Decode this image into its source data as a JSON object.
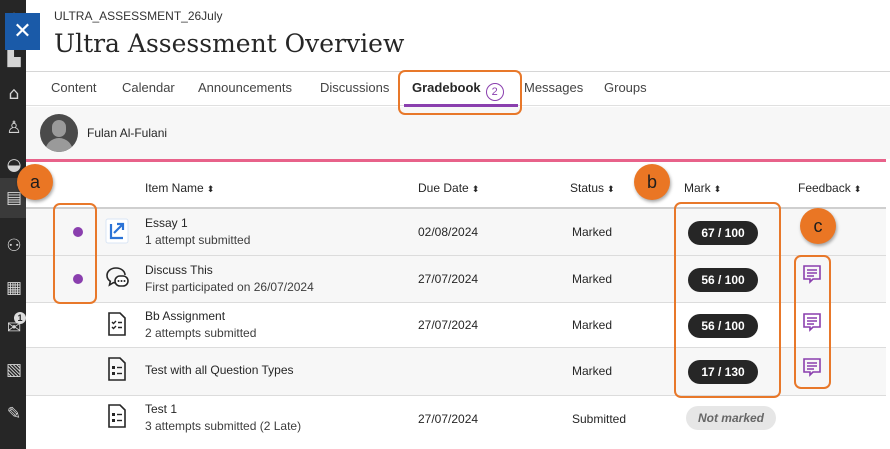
{
  "course_id": "ULTRA_ASSESSMENT_26July",
  "page_title": "Ultra Assessment Overview",
  "close_label": "✕",
  "tabs": [
    {
      "label": "Content"
    },
    {
      "label": "Calendar"
    },
    {
      "label": "Announcements"
    },
    {
      "label": "Discussions"
    },
    {
      "label": "Gradebook",
      "badge": "2",
      "active": true
    },
    {
      "label": "Messages"
    },
    {
      "label": "Groups"
    }
  ],
  "user": {
    "name": "Fulan Al-Fulani"
  },
  "rail_badge": "1",
  "columns": {
    "item_name": "Item Name",
    "due_date": "Due Date",
    "status": "Status",
    "mark": "Mark",
    "feedback": "Feedback",
    "sort_glyph": "⬍"
  },
  "rows": [
    {
      "title": "Essay 1",
      "subtitle": "1 attempt submitted",
      "due": "02/08/2024",
      "status": "Marked",
      "mark": "67 / 100",
      "new_activity": true,
      "feedback": false,
      "icon": "assignment-arrow-icon"
    },
    {
      "title": "Discuss This",
      "subtitle": "First participated on 26/07/2024",
      "due": "27/07/2024",
      "status": "Marked",
      "mark": "56 / 100",
      "new_activity": true,
      "feedback": true,
      "icon": "discussion-icon"
    },
    {
      "title": "Bb Assignment",
      "subtitle": "2 attempts submitted",
      "due": "27/07/2024",
      "status": "Marked",
      "mark": "56 / 100",
      "new_activity": false,
      "feedback": true,
      "icon": "assignment-doc-icon"
    },
    {
      "title": "Test with all Question Types",
      "subtitle": "",
      "due": "",
      "status": "Marked",
      "mark": "17 / 130",
      "new_activity": false,
      "feedback": true,
      "icon": "test-doc-icon"
    },
    {
      "title": "Test 1",
      "subtitle": "3 attempts submitted (2 Late)",
      "due": "27/07/2024",
      "status": "Submitted",
      "mark": "Not marked",
      "new_activity": false,
      "feedback": false,
      "icon": "test-doc-icon"
    }
  ],
  "callouts": {
    "a": "a",
    "b": "b",
    "c": "c"
  },
  "colors": {
    "accent_purple": "#8a3fae",
    "callout_orange": "#e8782a",
    "pink_line": "#e8628a",
    "dark_pill": "#262626"
  }
}
